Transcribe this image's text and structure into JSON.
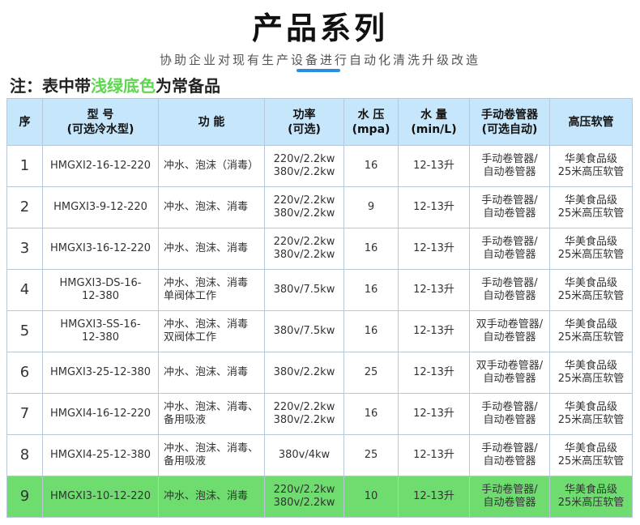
{
  "header": {
    "title": "产品系列",
    "subtitle": "协助企业对现有生产设备进行自动化清洗升级改造"
  },
  "note": {
    "prefix": "注：表中带",
    "highlight": "浅绿底色",
    "suffix": "为常备品",
    "highlight_color": "#5fd64f"
  },
  "table": {
    "header_bg": "#c6e6fb",
    "highlight_row_bg": "#6fdc6f",
    "columns": [
      {
        "line1": "序",
        "line2": ""
      },
      {
        "line1": "型 号",
        "line2": "(可选冷水型)"
      },
      {
        "line1": "功 能",
        "line2": ""
      },
      {
        "line1": "功率",
        "line2": "(可选)"
      },
      {
        "line1": "水 压",
        "line2": "(mpa)"
      },
      {
        "line1": "水 量",
        "line2": "(min/L)"
      },
      {
        "line1": "手动卷管器",
        "line2": "(可选自动)"
      },
      {
        "line1": "高压软管",
        "line2": ""
      }
    ],
    "rows": [
      {
        "idx": "1",
        "model1": "HMGXI2-16-12-220",
        "model2": "",
        "func1": "冲水、泡沫（消毒）",
        "func2": "",
        "power1": "220v/2.2kw",
        "power2": "380v/2.2kw",
        "pressure": "16",
        "flow": "12-13升",
        "reel1": "手动卷管器/",
        "reel2": "自动卷管器",
        "hose1": "华美食品级",
        "hose2": "25米高压软管"
      },
      {
        "idx": "2",
        "model1": "HMGXI3-9-12-220",
        "model2": "",
        "func1": "冲水、泡沫、消毒",
        "func2": "",
        "power1": "220v/2.2kw",
        "power2": "380v/2.2kw",
        "pressure": "9",
        "flow": "12-13升",
        "reel1": "手动卷管器/",
        "reel2": "自动卷管器",
        "hose1": "华美食品级",
        "hose2": "25米高压软管"
      },
      {
        "idx": "3",
        "model1": "HMGXI3-16-12-220",
        "model2": "",
        "func1": "冲水、泡沫、消毒",
        "func2": "",
        "power1": "220v/2.2kw",
        "power2": "380v/2.2kw",
        "pressure": "16",
        "flow": "12-13升",
        "reel1": "手动卷管器/",
        "reel2": "自动卷管器",
        "hose1": "华美食品级",
        "hose2": "25米高压软管"
      },
      {
        "idx": "4",
        "model1": "HMGXI3-DS-16-",
        "model2": "12-380",
        "func1": "冲水、泡沫、消毒",
        "func2": "单阀体工作",
        "power1": "380v/7.5kw",
        "power2": "",
        "pressure": "16",
        "flow": "12-13升",
        "reel1": "手动卷管器/",
        "reel2": "自动卷管器",
        "hose1": "华美食品级",
        "hose2": "25米高压软管"
      },
      {
        "idx": "5",
        "model1": "HMGXI3-SS-16-",
        "model2": "12-380",
        "func1": "冲水、泡沫、消毒",
        "func2": "双阀体工作",
        "power1": "380v/7.5kw",
        "power2": "",
        "pressure": "16",
        "flow": "12-13升",
        "reel1": "双手动卷管器/",
        "reel2": "自动卷管器",
        "hose1": "华美食品级",
        "hose2": "25米高压软管"
      },
      {
        "idx": "6",
        "model1": "HMGXI3-25-12-380",
        "model2": "",
        "func1": "冲水、泡沫、消毒",
        "func2": "",
        "power1": "380v/2.2kw",
        "power2": "",
        "pressure": "25",
        "flow": "12-13升",
        "reel1": "双手动卷管器/",
        "reel2": "自动卷管器",
        "hose1": "华美食品级",
        "hose2": "25米高压软管"
      },
      {
        "idx": "7",
        "model1": "HMGXI4-16-12-220",
        "model2": "",
        "func1": "冲水、泡沫、消毒、",
        "func2": "备用吸液",
        "power1": "220v/2.2kw",
        "power2": "380v/2.2kw",
        "pressure": "16",
        "flow": "12-13升",
        "reel1": "手动卷管器/",
        "reel2": "自动卷管器",
        "hose1": "华美食品级",
        "hose2": "25米高压软管"
      },
      {
        "idx": "8",
        "model1": "HMGXI4-25-12-380",
        "model2": "",
        "func1": "冲水、泡沫、消毒、",
        "func2": "备用吸液",
        "power1": "380v/4kw",
        "power2": "",
        "pressure": "25",
        "flow": "12-13升",
        "reel1": "手动卷管器/",
        "reel2": "自动卷管器",
        "hose1": "华美食品级",
        "hose2": "25米高压软管"
      },
      {
        "idx": "9",
        "model1": "HMGXI3-10-12-220",
        "model2": "",
        "func1": "冲水、泡沫、消毒",
        "func2": "",
        "power1": "220v/2.2kw",
        "power2": "380v/2.2kw",
        "pressure": "10",
        "flow": "12-13升",
        "reel1": "手动卷管器/",
        "reel2": "自动卷管器",
        "hose1": "华美食品级",
        "hose2": "25米高压软管",
        "highlight": true
      }
    ]
  }
}
